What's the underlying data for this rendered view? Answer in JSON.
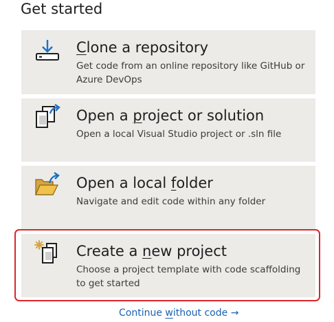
{
  "heading": "Get started",
  "cards": [
    {
      "id": "clone",
      "title_before": "",
      "title_key": "C",
      "title_after": "lone a repository",
      "description": "Get code from an online repository like GitHub or Azure DevOps",
      "icon": "download-repository-icon"
    },
    {
      "id": "open-project",
      "title_before": "Open a ",
      "title_key": "p",
      "title_after": "roject or solution",
      "description": "Open a local Visual Studio project or .sln file",
      "icon": "open-project-icon"
    },
    {
      "id": "open-folder",
      "title_before": "Open a local ",
      "title_key": "f",
      "title_after": "older",
      "description": "Navigate and edit code within any folder",
      "icon": "open-folder-icon"
    },
    {
      "id": "new-project",
      "title_before": "Create a ",
      "title_key": "n",
      "title_after": "ew project",
      "description": "Choose a project template with code scaffolding to get started",
      "icon": "new-project-icon"
    }
  ],
  "continue_link": {
    "before": "Continue ",
    "key": "w",
    "after": "ithout code",
    "arrow": "→"
  },
  "colors": {
    "card_background": "#edebe8",
    "highlight_border": "#d9262b",
    "link": "#1a61b0",
    "icon_blue": "#1c72c4",
    "folder_gold": "#d6a441"
  }
}
